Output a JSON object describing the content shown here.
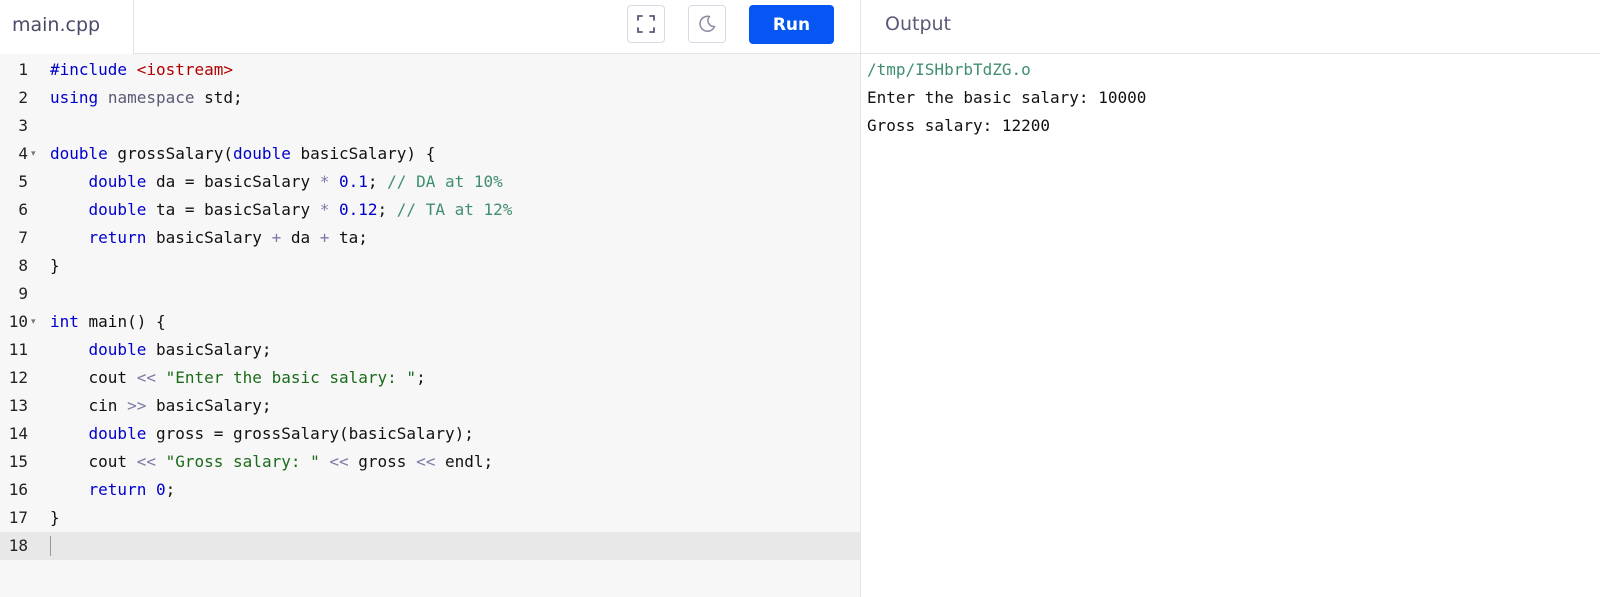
{
  "editor": {
    "file_name": "main.cpp",
    "lines": [
      {
        "no": "1",
        "fold": false,
        "tokens": [
          {
            "t": "inc-kw",
            "v": "#include "
          },
          {
            "t": "inc",
            "v": "<iostream>"
          }
        ]
      },
      {
        "no": "2",
        "fold": false,
        "tokens": [
          {
            "t": "kw",
            "v": "using"
          },
          {
            "t": "",
            "v": " "
          },
          {
            "t": "ns",
            "v": "namespace"
          },
          {
            "t": "",
            "v": " std;"
          }
        ]
      },
      {
        "no": "3",
        "fold": false,
        "tokens": []
      },
      {
        "no": "4",
        "fold": true,
        "tokens": [
          {
            "t": "kw",
            "v": "double"
          },
          {
            "t": "",
            "v": " grossSalary("
          },
          {
            "t": "kw",
            "v": "double"
          },
          {
            "t": "",
            "v": " basicSalary) {"
          }
        ]
      },
      {
        "no": "5",
        "fold": false,
        "tokens": [
          {
            "t": "",
            "v": "    "
          },
          {
            "t": "kw",
            "v": "double"
          },
          {
            "t": "",
            "v": " da = basicSalary "
          },
          {
            "t": "op",
            "v": "*"
          },
          {
            "t": "",
            "v": " "
          },
          {
            "t": "num",
            "v": "0.1"
          },
          {
            "t": "",
            "v": "; "
          },
          {
            "t": "com",
            "v": "// DA at 10%"
          }
        ]
      },
      {
        "no": "6",
        "fold": false,
        "tokens": [
          {
            "t": "",
            "v": "    "
          },
          {
            "t": "kw",
            "v": "double"
          },
          {
            "t": "",
            "v": " ta = basicSalary "
          },
          {
            "t": "op",
            "v": "*"
          },
          {
            "t": "",
            "v": " "
          },
          {
            "t": "num",
            "v": "0.12"
          },
          {
            "t": "",
            "v": "; "
          },
          {
            "t": "com",
            "v": "// TA at 12%"
          }
        ]
      },
      {
        "no": "7",
        "fold": false,
        "tokens": [
          {
            "t": "",
            "v": "    "
          },
          {
            "t": "kw",
            "v": "return"
          },
          {
            "t": "",
            "v": " basicSalary "
          },
          {
            "t": "op",
            "v": "+"
          },
          {
            "t": "",
            "v": " da "
          },
          {
            "t": "op",
            "v": "+"
          },
          {
            "t": "",
            "v": " ta;"
          }
        ]
      },
      {
        "no": "8",
        "fold": false,
        "tokens": [
          {
            "t": "",
            "v": "}"
          }
        ]
      },
      {
        "no": "9",
        "fold": false,
        "tokens": []
      },
      {
        "no": "10",
        "fold": true,
        "tokens": [
          {
            "t": "kw",
            "v": "int"
          },
          {
            "t": "",
            "v": " main() {"
          }
        ]
      },
      {
        "no": "11",
        "fold": false,
        "tokens": [
          {
            "t": "",
            "v": "    "
          },
          {
            "t": "kw",
            "v": "double"
          },
          {
            "t": "",
            "v": " basicSalary;"
          }
        ]
      },
      {
        "no": "12",
        "fold": false,
        "tokens": [
          {
            "t": "",
            "v": "    cout "
          },
          {
            "t": "op",
            "v": "<<"
          },
          {
            "t": "",
            "v": " "
          },
          {
            "t": "str",
            "v": "\"Enter the basic salary: \""
          },
          {
            "t": "",
            "v": ";"
          }
        ]
      },
      {
        "no": "13",
        "fold": false,
        "tokens": [
          {
            "t": "",
            "v": "    cin "
          },
          {
            "t": "op",
            "v": ">>"
          },
          {
            "t": "",
            "v": " basicSalary;"
          }
        ]
      },
      {
        "no": "14",
        "fold": false,
        "tokens": [
          {
            "t": "",
            "v": "    "
          },
          {
            "t": "kw",
            "v": "double"
          },
          {
            "t": "",
            "v": " gross = grossSalary(basicSalary);"
          }
        ]
      },
      {
        "no": "15",
        "fold": false,
        "tokens": [
          {
            "t": "",
            "v": "    cout "
          },
          {
            "t": "op",
            "v": "<<"
          },
          {
            "t": "",
            "v": " "
          },
          {
            "t": "str",
            "v": "\"Gross salary: \""
          },
          {
            "t": "",
            "v": " "
          },
          {
            "t": "op",
            "v": "<<"
          },
          {
            "t": "",
            "v": " gross "
          },
          {
            "t": "op",
            "v": "<<"
          },
          {
            "t": "",
            "v": " endl;"
          }
        ]
      },
      {
        "no": "16",
        "fold": false,
        "tokens": [
          {
            "t": "",
            "v": "    "
          },
          {
            "t": "kw",
            "v": "return"
          },
          {
            "t": "",
            "v": " "
          },
          {
            "t": "num",
            "v": "0"
          },
          {
            "t": "",
            "v": ";"
          }
        ]
      },
      {
        "no": "17",
        "fold": false,
        "tokens": [
          {
            "t": "",
            "v": "}"
          }
        ]
      },
      {
        "no": "18",
        "fold": false,
        "active": true,
        "tokens": []
      }
    ]
  },
  "toolbar": {
    "fullscreen_icon": "fullscreen-icon",
    "theme_icon": "moon-icon",
    "run_label": "Run"
  },
  "output": {
    "title": "Output",
    "lines": [
      {
        "kind": "path",
        "text": "/tmp/ISHbrbTdZG.o"
      },
      {
        "kind": "text",
        "text": "Enter the basic salary: 10000"
      },
      {
        "kind": "text",
        "text": "Gross salary: 12200"
      }
    ]
  },
  "colors": {
    "run_button": "#0556f3",
    "keyword": "#0000cc",
    "string": "#1a6b1a",
    "include": "#b00000",
    "comment": "#3f8f6f"
  }
}
